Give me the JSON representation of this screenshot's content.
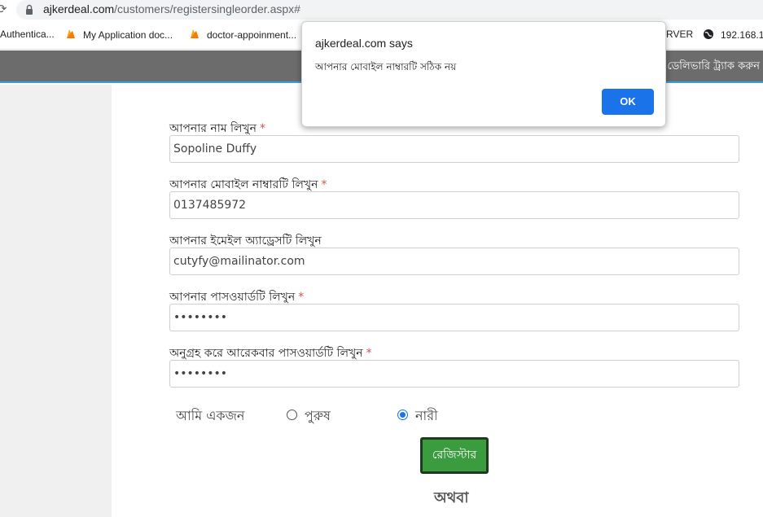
{
  "browser": {
    "url_host": "ajkerdeal.com",
    "url_path": "/customers/registersingleorder.aspx#"
  },
  "bookmarks": [
    {
      "label": "Authentica..."
    },
    {
      "label": "My Application doc..."
    },
    {
      "label": "doctor-appoinment..."
    },
    {
      "label": "RVER"
    },
    {
      "label": "192.168.1"
    }
  ],
  "navbar": {
    "track_label": "ডেলিভারি ট্র্যাক করুন"
  },
  "form": {
    "name_label": "আপনার নাম লিখুন",
    "name_value": "Sopoline Duffy",
    "mobile_label": "আপনার মোবাইল নাম্বারটি লিখুন",
    "mobile_value": "0137485972",
    "email_label": "আপনার ইমেইল অ্যাড্রেসটি লিখুন",
    "email_value": "cutyfy@mailinator.com",
    "password_label": "আপনার পাসওয়ার্ডটি লিখুন",
    "password_value": "••••••••",
    "confirm_label": "অনুগ্রহ করে আরেকবার পাসওয়ার্ডটি লিখুন",
    "confirm_value": "••••••••",
    "required_mark": "*",
    "gender_label": "আমি একজন",
    "gender_male": "পুরুষ",
    "gender_female": "নারী",
    "gender_selected": "নারী",
    "register_label": "রেজিস্টার",
    "or_label": "অথবা"
  },
  "dialog": {
    "title": "ajkerdeal.com says",
    "message": "আপনার মোবাইল নাম্বারটি সঠিক নয়",
    "ok_label": "OK"
  },
  "colors": {
    "navbar": "#6c6c6c",
    "accent_line": "#3aa0dc",
    "register_button": "#3b9b3f",
    "dialog_button": "#1a73e8",
    "required": "#d9534f"
  }
}
